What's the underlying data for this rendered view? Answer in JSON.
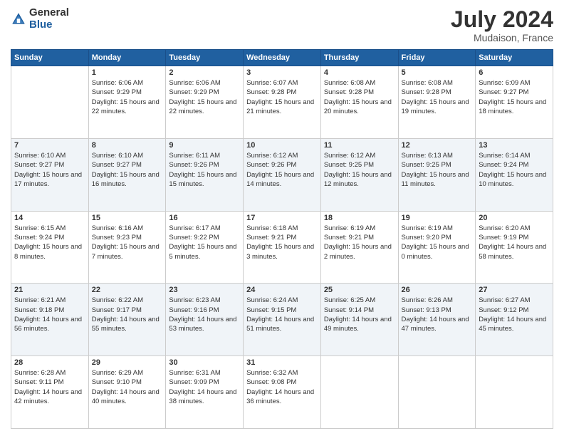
{
  "logo": {
    "general": "General",
    "blue": "Blue"
  },
  "header": {
    "month_year": "July 2024",
    "location": "Mudaison, France"
  },
  "days_of_week": [
    "Sunday",
    "Monday",
    "Tuesday",
    "Wednesday",
    "Thursday",
    "Friday",
    "Saturday"
  ],
  "weeks": [
    [
      {
        "day": "",
        "sunrise": "",
        "sunset": "",
        "daylight": ""
      },
      {
        "day": "1",
        "sunrise": "Sunrise: 6:06 AM",
        "sunset": "Sunset: 9:29 PM",
        "daylight": "Daylight: 15 hours and 22 minutes."
      },
      {
        "day": "2",
        "sunrise": "Sunrise: 6:06 AM",
        "sunset": "Sunset: 9:29 PM",
        "daylight": "Daylight: 15 hours and 22 minutes."
      },
      {
        "day": "3",
        "sunrise": "Sunrise: 6:07 AM",
        "sunset": "Sunset: 9:28 PM",
        "daylight": "Daylight: 15 hours and 21 minutes."
      },
      {
        "day": "4",
        "sunrise": "Sunrise: 6:08 AM",
        "sunset": "Sunset: 9:28 PM",
        "daylight": "Daylight: 15 hours and 20 minutes."
      },
      {
        "day": "5",
        "sunrise": "Sunrise: 6:08 AM",
        "sunset": "Sunset: 9:28 PM",
        "daylight": "Daylight: 15 hours and 19 minutes."
      },
      {
        "day": "6",
        "sunrise": "Sunrise: 6:09 AM",
        "sunset": "Sunset: 9:27 PM",
        "daylight": "Daylight: 15 hours and 18 minutes."
      }
    ],
    [
      {
        "day": "7",
        "sunrise": "Sunrise: 6:10 AM",
        "sunset": "Sunset: 9:27 PM",
        "daylight": "Daylight: 15 hours and 17 minutes."
      },
      {
        "day": "8",
        "sunrise": "Sunrise: 6:10 AM",
        "sunset": "Sunset: 9:27 PM",
        "daylight": "Daylight: 15 hours and 16 minutes."
      },
      {
        "day": "9",
        "sunrise": "Sunrise: 6:11 AM",
        "sunset": "Sunset: 9:26 PM",
        "daylight": "Daylight: 15 hours and 15 minutes."
      },
      {
        "day": "10",
        "sunrise": "Sunrise: 6:12 AM",
        "sunset": "Sunset: 9:26 PM",
        "daylight": "Daylight: 15 hours and 14 minutes."
      },
      {
        "day": "11",
        "sunrise": "Sunrise: 6:12 AM",
        "sunset": "Sunset: 9:25 PM",
        "daylight": "Daylight: 15 hours and 12 minutes."
      },
      {
        "day": "12",
        "sunrise": "Sunrise: 6:13 AM",
        "sunset": "Sunset: 9:25 PM",
        "daylight": "Daylight: 15 hours and 11 minutes."
      },
      {
        "day": "13",
        "sunrise": "Sunrise: 6:14 AM",
        "sunset": "Sunset: 9:24 PM",
        "daylight": "Daylight: 15 hours and 10 minutes."
      }
    ],
    [
      {
        "day": "14",
        "sunrise": "Sunrise: 6:15 AM",
        "sunset": "Sunset: 9:24 PM",
        "daylight": "Daylight: 15 hours and 8 minutes."
      },
      {
        "day": "15",
        "sunrise": "Sunrise: 6:16 AM",
        "sunset": "Sunset: 9:23 PM",
        "daylight": "Daylight: 15 hours and 7 minutes."
      },
      {
        "day": "16",
        "sunrise": "Sunrise: 6:17 AM",
        "sunset": "Sunset: 9:22 PM",
        "daylight": "Daylight: 15 hours and 5 minutes."
      },
      {
        "day": "17",
        "sunrise": "Sunrise: 6:18 AM",
        "sunset": "Sunset: 9:21 PM",
        "daylight": "Daylight: 15 hours and 3 minutes."
      },
      {
        "day": "18",
        "sunrise": "Sunrise: 6:19 AM",
        "sunset": "Sunset: 9:21 PM",
        "daylight": "Daylight: 15 hours and 2 minutes."
      },
      {
        "day": "19",
        "sunrise": "Sunrise: 6:19 AM",
        "sunset": "Sunset: 9:20 PM",
        "daylight": "Daylight: 15 hours and 0 minutes."
      },
      {
        "day": "20",
        "sunrise": "Sunrise: 6:20 AM",
        "sunset": "Sunset: 9:19 PM",
        "daylight": "Daylight: 14 hours and 58 minutes."
      }
    ],
    [
      {
        "day": "21",
        "sunrise": "Sunrise: 6:21 AM",
        "sunset": "Sunset: 9:18 PM",
        "daylight": "Daylight: 14 hours and 56 minutes."
      },
      {
        "day": "22",
        "sunrise": "Sunrise: 6:22 AM",
        "sunset": "Sunset: 9:17 PM",
        "daylight": "Daylight: 14 hours and 55 minutes."
      },
      {
        "day": "23",
        "sunrise": "Sunrise: 6:23 AM",
        "sunset": "Sunset: 9:16 PM",
        "daylight": "Daylight: 14 hours and 53 minutes."
      },
      {
        "day": "24",
        "sunrise": "Sunrise: 6:24 AM",
        "sunset": "Sunset: 9:15 PM",
        "daylight": "Daylight: 14 hours and 51 minutes."
      },
      {
        "day": "25",
        "sunrise": "Sunrise: 6:25 AM",
        "sunset": "Sunset: 9:14 PM",
        "daylight": "Daylight: 14 hours and 49 minutes."
      },
      {
        "day": "26",
        "sunrise": "Sunrise: 6:26 AM",
        "sunset": "Sunset: 9:13 PM",
        "daylight": "Daylight: 14 hours and 47 minutes."
      },
      {
        "day": "27",
        "sunrise": "Sunrise: 6:27 AM",
        "sunset": "Sunset: 9:12 PM",
        "daylight": "Daylight: 14 hours and 45 minutes."
      }
    ],
    [
      {
        "day": "28",
        "sunrise": "Sunrise: 6:28 AM",
        "sunset": "Sunset: 9:11 PM",
        "daylight": "Daylight: 14 hours and 42 minutes."
      },
      {
        "day": "29",
        "sunrise": "Sunrise: 6:29 AM",
        "sunset": "Sunset: 9:10 PM",
        "daylight": "Daylight: 14 hours and 40 minutes."
      },
      {
        "day": "30",
        "sunrise": "Sunrise: 6:31 AM",
        "sunset": "Sunset: 9:09 PM",
        "daylight": "Daylight: 14 hours and 38 minutes."
      },
      {
        "day": "31",
        "sunrise": "Sunrise: 6:32 AM",
        "sunset": "Sunset: 9:08 PM",
        "daylight": "Daylight: 14 hours and 36 minutes."
      },
      {
        "day": "",
        "sunrise": "",
        "sunset": "",
        "daylight": ""
      },
      {
        "day": "",
        "sunrise": "",
        "sunset": "",
        "daylight": ""
      },
      {
        "day": "",
        "sunrise": "",
        "sunset": "",
        "daylight": ""
      }
    ]
  ]
}
